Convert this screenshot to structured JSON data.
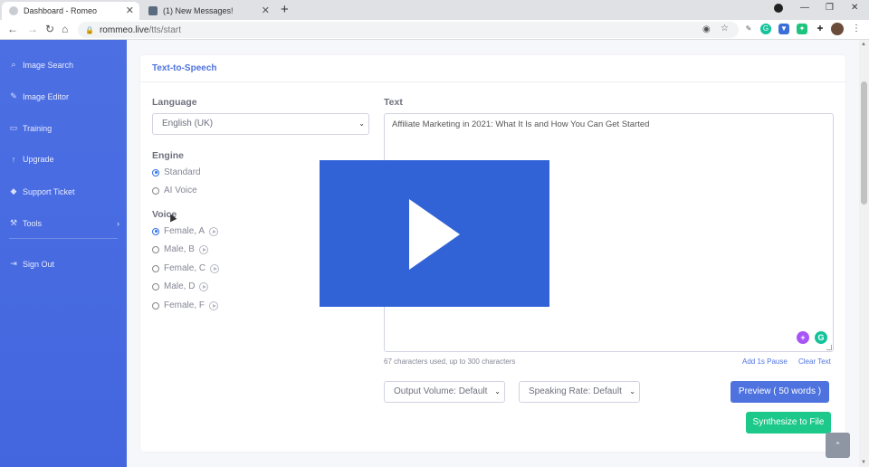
{
  "browser": {
    "tabs": [
      {
        "title": "Dashboard - Romeo",
        "active": true
      },
      {
        "title": "(1) New Messages!",
        "active": false
      }
    ],
    "url_host": "rommeo.live",
    "url_path": "/tts/start"
  },
  "sidebar": {
    "items": [
      {
        "label": "Image Search",
        "icon": "search-icon"
      },
      {
        "label": "Image Editor",
        "icon": "edit-icon"
      },
      {
        "label": "Training",
        "icon": "monitor-icon"
      },
      {
        "label": "Upgrade",
        "icon": "arrow-up-icon"
      },
      {
        "label": "Support Ticket",
        "icon": "tag-icon"
      },
      {
        "label": "Tools",
        "icon": "wrench-icon"
      },
      {
        "label": "Sign Out",
        "icon": "sign-out-icon"
      }
    ]
  },
  "card": {
    "title": "Text-to-Speech",
    "language_label": "Language",
    "language_value": "English (UK)",
    "engine_label": "Engine",
    "engines": [
      {
        "label": "Standard",
        "checked": true
      },
      {
        "label": "AI Voice",
        "checked": false
      }
    ],
    "voice_label": "Voice",
    "voices": [
      {
        "label": "Female, A",
        "checked": true
      },
      {
        "label": "Male, B",
        "checked": false
      },
      {
        "label": "Female, C",
        "checked": false
      },
      {
        "label": "Male, D",
        "checked": false
      },
      {
        "label": "Female, F",
        "checked": false
      }
    ],
    "text_label": "Text",
    "text_value": "Affiliate Marketing in 2021: What It Is and How You Can Get Started",
    "char_count": "67 characters used, up to 300 characters",
    "add_pause": "Add 1s Pause",
    "clear_text": "Clear Text",
    "output_volume": "Output Volume: Default",
    "speaking_rate": "Speaking Rate: Default",
    "preview_button": "Preview ( 50 words )",
    "synthesize_button": "Synthesize to File"
  },
  "colors": {
    "sidebar": "#4c6fe3",
    "primary": "#4e73df",
    "success": "#1cc88a",
    "video": "#3163d6"
  }
}
